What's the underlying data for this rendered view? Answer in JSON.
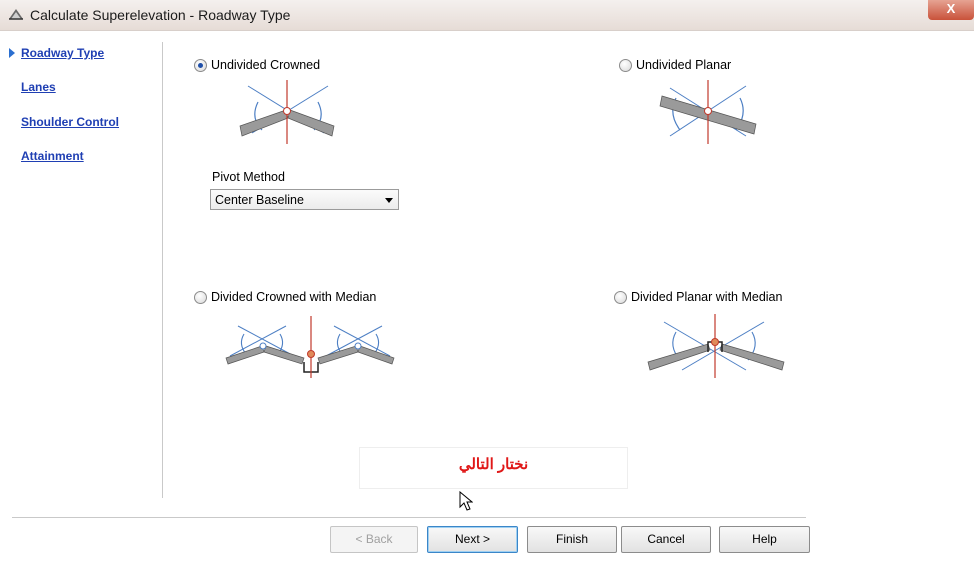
{
  "window": {
    "title": "Calculate Superelevation - Roadway Type",
    "close_label": "X"
  },
  "nav": {
    "items": [
      {
        "label": "Roadway Type",
        "active": true
      },
      {
        "label": "Lanes"
      },
      {
        "label": "Shoulder Control"
      },
      {
        "label": "Attainment"
      }
    ]
  },
  "options": {
    "undivided_crowned": {
      "label": "Undivided Crowned",
      "checked": true
    },
    "undivided_planar": {
      "label": "Undivided Planar",
      "checked": false
    },
    "divided_crowned": {
      "label": "Divided Crowned with Median",
      "checked": false
    },
    "divided_planar": {
      "label": "Divided Planar with Median",
      "checked": false
    }
  },
  "pivot": {
    "label": "Pivot Method",
    "value": "Center Baseline"
  },
  "annotation": {
    "text": "نختار التالي"
  },
  "buttons": {
    "back": "< Back",
    "next": "Next >",
    "finish": "Finish",
    "cancel": "Cancel",
    "help": "Help"
  },
  "colors": {
    "accent": "#2b6fd0",
    "link": "#1f3fb3",
    "annotation": "#e01818"
  }
}
